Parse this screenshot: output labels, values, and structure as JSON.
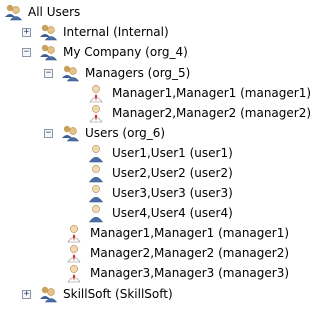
{
  "tree": {
    "root": {
      "label": "All Users",
      "icon": "group-icon",
      "toggle": "−"
    },
    "nodes": [
      {
        "label": "Internal (Internal)",
        "icon": "group-icon",
        "toggle": "+"
      },
      {
        "label": "My Company (org_4)",
        "icon": "group-icon",
        "toggle": "−"
      },
      {
        "label": "Managers (org_5)",
        "icon": "group-icon",
        "toggle": "−"
      },
      {
        "label": "Manager1,Manager1 (manager1)",
        "icon": "manager-user-icon"
      },
      {
        "label": "Manager2,Manager2 (manager2)",
        "icon": "manager-user-icon"
      },
      {
        "label": "Users (org_6)",
        "icon": "group-icon",
        "toggle": "−"
      },
      {
        "label": "User1,User1 (user1)",
        "icon": "user-icon"
      },
      {
        "label": "User2,User2 (user2)",
        "icon": "user-icon"
      },
      {
        "label": "User3,User3 (user3)",
        "icon": "user-icon"
      },
      {
        "label": "User4,User4 (user4)",
        "icon": "user-icon"
      },
      {
        "label": "Manager1,Manager1 (manager1)",
        "icon": "manager-user-icon"
      },
      {
        "label": "Manager2,Manager2 (manager2)",
        "icon": "manager-user-icon"
      },
      {
        "label": "Manager3,Manager3 (manager3)",
        "icon": "manager-user-icon"
      },
      {
        "label": "SkillSoft (SkillSoft)",
        "icon": "group-icon",
        "toggle": "+"
      }
    ]
  },
  "colors": {
    "group_head_back": "#c9a35d",
    "group_head_front": "#e6c38a",
    "user_body": "#4a6fa8",
    "manager_tie": "#d43a3a",
    "connector": "#9aa3ad"
  }
}
